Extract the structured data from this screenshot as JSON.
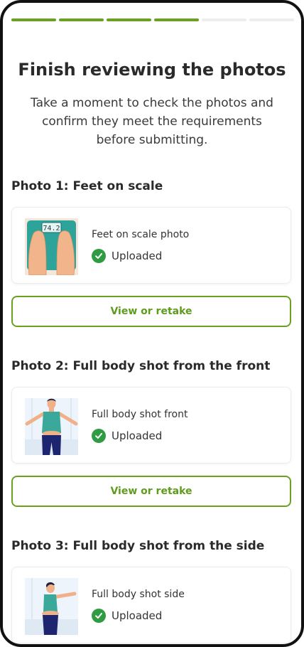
{
  "progress": {
    "total_steps": 6,
    "completed_steps": 4
  },
  "header": {
    "title": "Finish reviewing the photos",
    "subtitle": "Take a moment to check the photos and confirm they meet the requirements before submitting."
  },
  "photos": [
    {
      "heading": "Photo 1: Feet on scale",
      "label": "Feet on scale photo",
      "status": "Uploaded",
      "button": "View or retake",
      "scale_reading": "74.2"
    },
    {
      "heading": "Photo 2: Full body shot from the front",
      "label": "Full body shot front",
      "status": "Uploaded",
      "button": "View or retake"
    },
    {
      "heading": "Photo 3: Full body shot from the side",
      "label": "Full body shot side",
      "status": "Uploaded"
    }
  ],
  "colors": {
    "accent": "#6aa121",
    "success": "#2f9b42",
    "text": "#2a2a2a"
  }
}
